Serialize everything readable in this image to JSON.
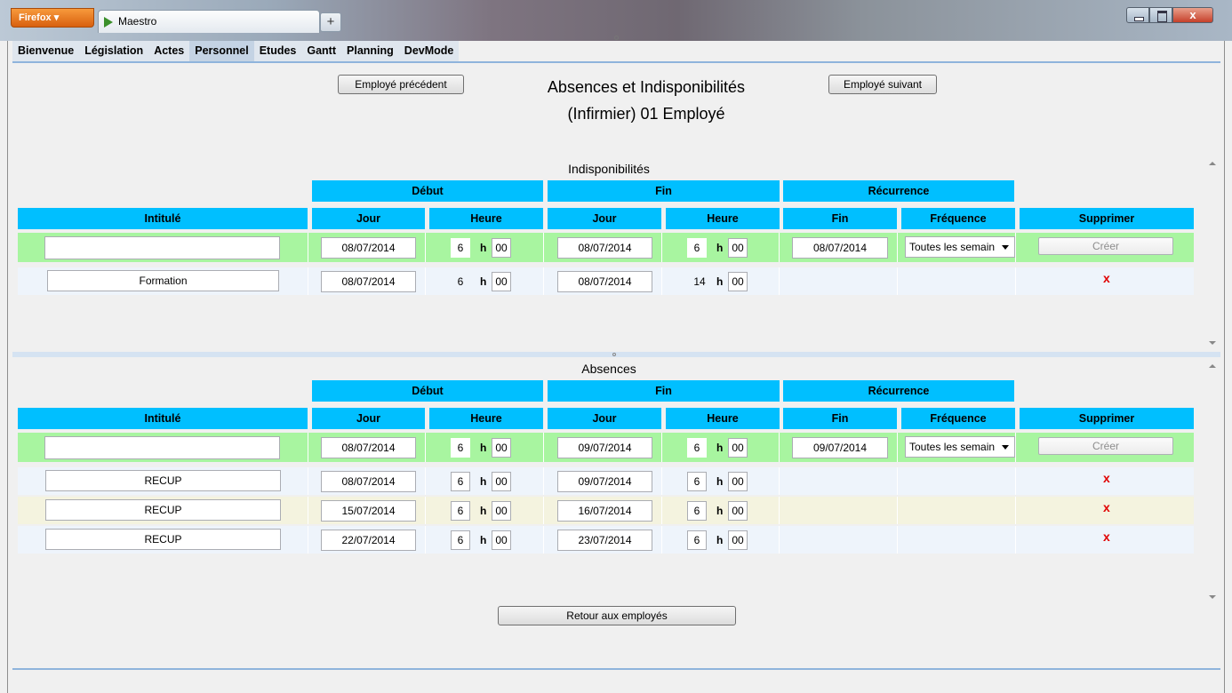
{
  "browser": {
    "menu_label": "Firefox",
    "tab_title": "Maestro",
    "new_tab_label": "+",
    "close_label": "x"
  },
  "nav": {
    "items": [
      "Bienvenue",
      "Législation",
      "Actes",
      "Personnel",
      "Etudes",
      "Gantt",
      "Planning",
      "DevMode"
    ],
    "active": "Personnel"
  },
  "header": {
    "prev_button": "Employé précédent",
    "next_button": "Employé suivant",
    "title_line1": "Absences et Indisponibilités",
    "title_line2": "(Infirmier) 01 Employé"
  },
  "columns": {
    "group_start": "Début",
    "group_end": "Fin",
    "group_recurrence": "Récurrence",
    "intitule": "Intitulé",
    "jour": "Jour",
    "heure": "Heure",
    "fin": "Fin",
    "frequence": "Fréquence",
    "supprimer": "Supprimer",
    "h_sep": "h"
  },
  "indisponibilites": {
    "title": "Indisponibilités",
    "new_row": {
      "intitule": "",
      "debut_jour": "08/07/2014",
      "debut_h": "6",
      "debut_m": "00",
      "fin_jour": "08/07/2014",
      "fin_h": "6",
      "fin_m": "00",
      "rec_fin": "08/07/2014",
      "frequence": "Toutes les semaines",
      "create_label": "Créer"
    },
    "rows": [
      {
        "intitule": "Formation",
        "debut_jour": "08/07/2014",
        "debut_h": "6",
        "debut_m": "00",
        "fin_jour": "08/07/2014",
        "fin_h": "14",
        "fin_m": "00",
        "delete": "x"
      }
    ]
  },
  "absences": {
    "title": "Absences",
    "new_row": {
      "intitule": "",
      "debut_jour": "08/07/2014",
      "debut_h": "6",
      "debut_m": "00",
      "fin_jour": "09/07/2014",
      "fin_h": "6",
      "fin_m": "00",
      "rec_fin": "09/07/2014",
      "frequence": "Toutes les semaines",
      "create_label": "Créer"
    },
    "rows": [
      {
        "intitule": "RECUP",
        "debut_jour": "08/07/2014",
        "debut_h": "6",
        "debut_m": "00",
        "fin_jour": "09/07/2014",
        "fin_h": "6",
        "fin_m": "00",
        "delete": "x"
      },
      {
        "intitule": "RECUP",
        "debut_jour": "15/07/2014",
        "debut_h": "6",
        "debut_m": "00",
        "fin_jour": "16/07/2014",
        "fin_h": "6",
        "fin_m": "00",
        "delete": "x"
      },
      {
        "intitule": "RECUP",
        "debut_jour": "22/07/2014",
        "debut_h": "6",
        "debut_m": "00",
        "fin_jour": "23/07/2014",
        "fin_h": "6",
        "fin_m": "00",
        "delete": "x"
      }
    ]
  },
  "footer": {
    "back_button": "Retour aux employés"
  }
}
